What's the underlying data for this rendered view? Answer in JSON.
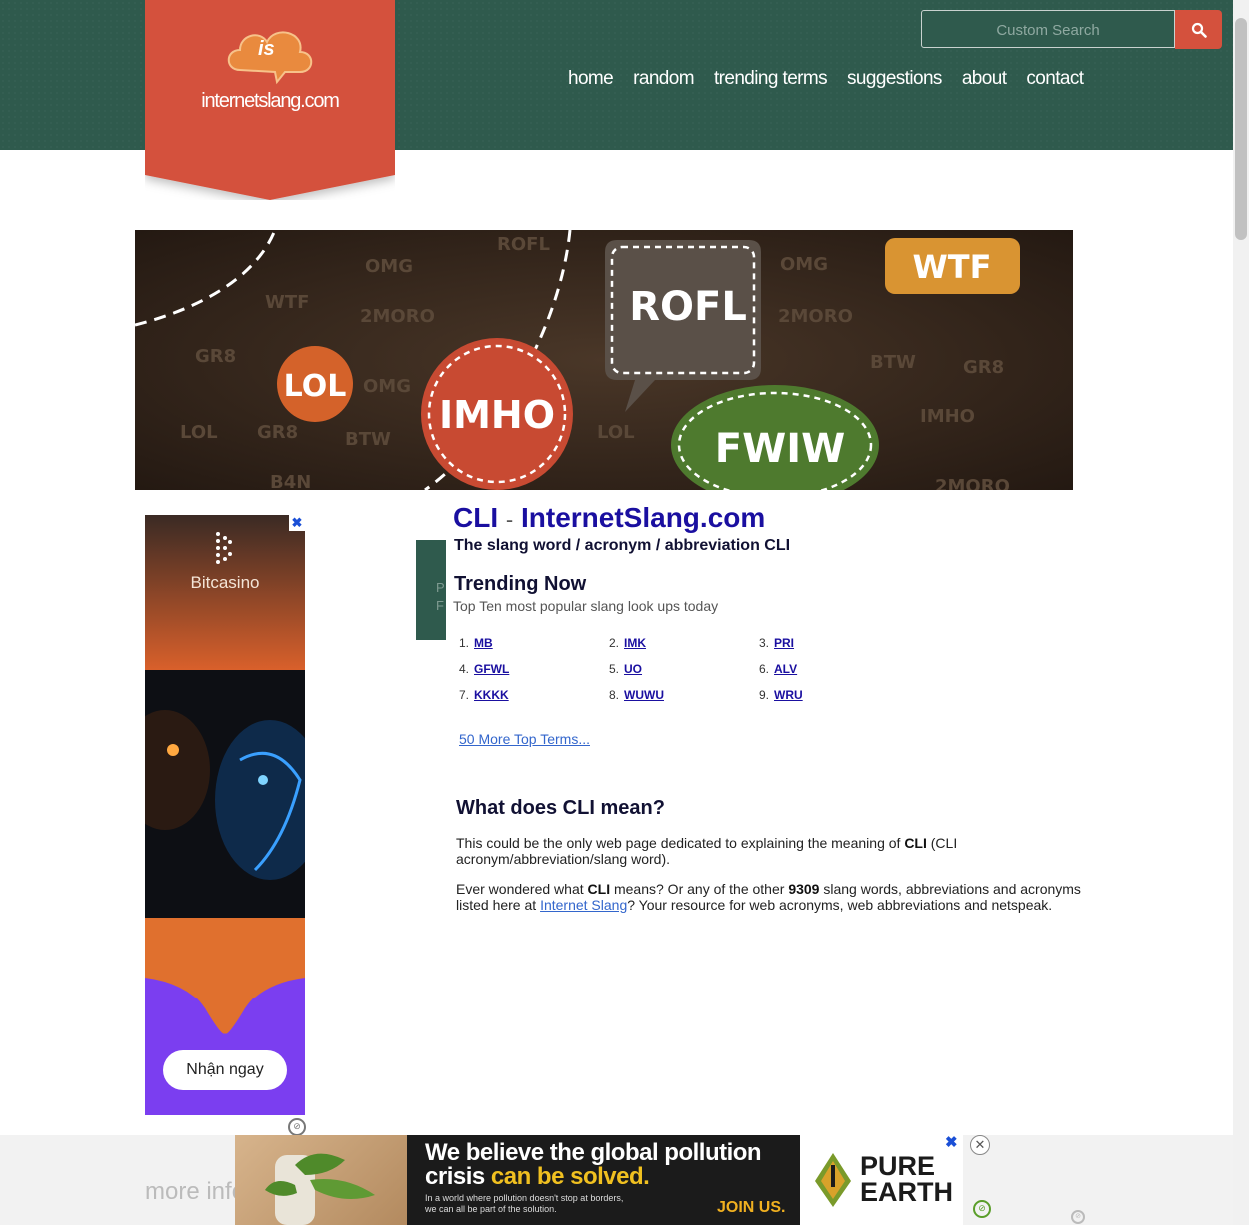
{
  "header": {
    "logo_badge": "is",
    "logo_text": "internetslang.com",
    "search_placeholder": "Custom Search",
    "nav": [
      "home",
      "random",
      "trending terms",
      "suggestions",
      "about",
      "contact"
    ],
    "colors": {
      "header_bg": "#2f5a4d",
      "logo_bg": "#d4513d"
    }
  },
  "banner": {
    "bubbles": [
      "LOL",
      "IMHO",
      "ROFL",
      "FWIW",
      "WTF"
    ],
    "background_words": [
      "OMG",
      "2MORO",
      "GR8",
      "WTF",
      "BTW",
      "ROFL",
      "IMHO",
      "LOL",
      "B4N"
    ]
  },
  "side_ad": {
    "brand": "Bitcasino",
    "cta": "Nhận ngay"
  },
  "side_strip": [
    "P",
    "F"
  ],
  "main": {
    "title_term": "CLI",
    "title_sep": "-",
    "title_site": "InternetSlang.com",
    "subtitle": "The slang word / acronym / abbreviation CLI",
    "trending_heading": "Trending Now",
    "trending_sub": "Top Ten most popular slang look ups today",
    "trending": [
      {
        "n": "1.",
        "term": "MB"
      },
      {
        "n": "2.",
        "term": "IMK"
      },
      {
        "n": "3.",
        "term": "PRI"
      },
      {
        "n": "4.",
        "term": "GFWL"
      },
      {
        "n": "5.",
        "term": "UO"
      },
      {
        "n": "6.",
        "term": "ALV"
      },
      {
        "n": "7.",
        "term": "KKKK"
      },
      {
        "n": "8.",
        "term": "WUWU"
      },
      {
        "n": "9.",
        "term": "WRU"
      }
    ],
    "more_terms": "50 More Top Terms...",
    "what_heading": "What does CLI mean?",
    "p1_a": "This could be the only web page dedicated to explaining the meaning of ",
    "p1_b": "CLI",
    "p1_c": " (CLI acronym/abbreviation/slang word).",
    "p2_a": "Ever wondered what ",
    "p2_b": "CLI",
    "p2_c": " means? Or any of the other ",
    "p2_d": "9309",
    "p2_e": " slang words, abbreviations and acronyms listed here at ",
    "p2_link": "Internet Slang",
    "p2_f": "? Your resource for web acronyms, web abbreviations and netspeak."
  },
  "bottom": {
    "more_info": "more info",
    "ad_line1": "We believe the global pollution",
    "ad_line2a": "crisis ",
    "ad_line2b": "can be solved.",
    "ad_small1": "In a world where pollution doesn't stop at borders,",
    "ad_small2": "we can all be part of the solution.",
    "ad_join": "JOIN US.",
    "ad_pure": "PURE",
    "ad_earth": "EARTH",
    "ad_close": "✕",
    "ad_x": "✖"
  }
}
